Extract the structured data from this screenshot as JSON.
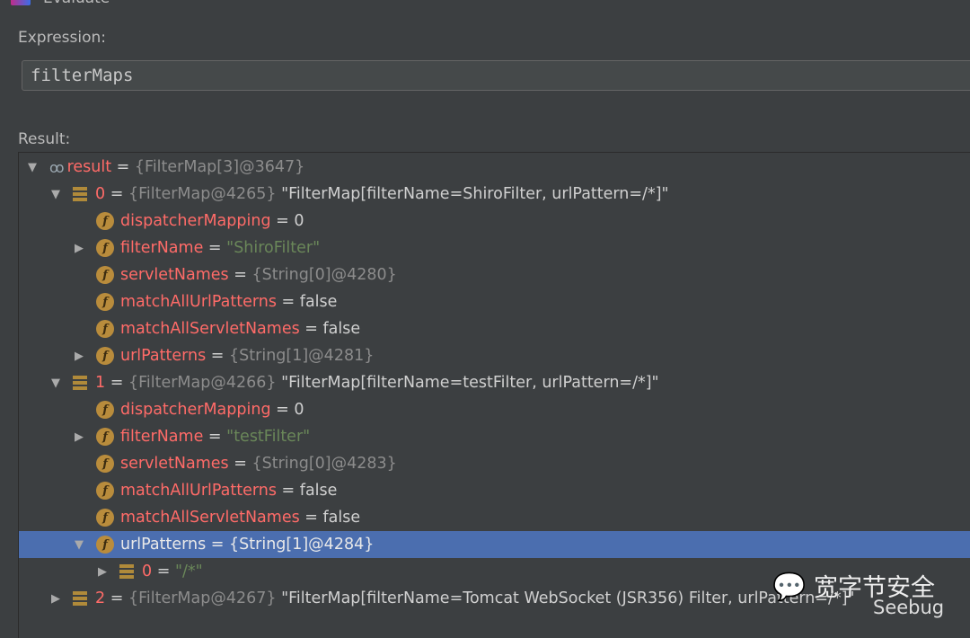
{
  "window": {
    "title": "Evaluate"
  },
  "expression": {
    "label": "Expression:",
    "value": "filterMaps"
  },
  "result": {
    "label": "Result:",
    "rows": [
      {
        "level": 0,
        "arrow": "down",
        "icon": "watch",
        "name": "result",
        "type": "{FilterMap[3]@3647}",
        "value": "",
        "kind": "val"
      },
      {
        "level": 1,
        "arrow": "down",
        "icon": "array",
        "name": "0",
        "type": "{FilterMap@4265}",
        "value": "\"FilterMap[filterName=ShiroFilter, urlPattern=/*]\"",
        "kind": "val"
      },
      {
        "level": 2,
        "arrow": "",
        "icon": "field",
        "name": "dispatcherMapping",
        "type": "",
        "value": "0",
        "kind": "val"
      },
      {
        "level": 2,
        "arrow": "right",
        "icon": "field",
        "name": "filterName",
        "type": "",
        "value": "\"ShiroFilter\"",
        "kind": "str"
      },
      {
        "level": 2,
        "arrow": "",
        "icon": "field",
        "name": "servletNames",
        "type": "{String[0]@4280}",
        "value": "",
        "kind": "val"
      },
      {
        "level": 2,
        "arrow": "",
        "icon": "field",
        "name": "matchAllUrlPatterns",
        "type": "",
        "value": "false",
        "kind": "val"
      },
      {
        "level": 2,
        "arrow": "",
        "icon": "field",
        "name": "matchAllServletNames",
        "type": "",
        "value": "false",
        "kind": "val"
      },
      {
        "level": 2,
        "arrow": "right",
        "icon": "field",
        "name": "urlPatterns",
        "type": "{String[1]@4281}",
        "value": "",
        "kind": "val"
      },
      {
        "level": 1,
        "arrow": "down",
        "icon": "array",
        "name": "1",
        "type": "{FilterMap@4266}",
        "value": "\"FilterMap[filterName=testFilter, urlPattern=/*]\"",
        "kind": "val"
      },
      {
        "level": 2,
        "arrow": "",
        "icon": "field",
        "name": "dispatcherMapping",
        "type": "",
        "value": "0",
        "kind": "val"
      },
      {
        "level": 2,
        "arrow": "right",
        "icon": "field",
        "name": "filterName",
        "type": "",
        "value": "\"testFilter\"",
        "kind": "str"
      },
      {
        "level": 2,
        "arrow": "",
        "icon": "field",
        "name": "servletNames",
        "type": "{String[0]@4283}",
        "value": "",
        "kind": "val"
      },
      {
        "level": 2,
        "arrow": "",
        "icon": "field",
        "name": "matchAllUrlPatterns",
        "type": "",
        "value": "false",
        "kind": "val"
      },
      {
        "level": 2,
        "arrow": "",
        "icon": "field",
        "name": "matchAllServletNames",
        "type": "",
        "value": "false",
        "kind": "val"
      },
      {
        "level": 2,
        "arrow": "down",
        "icon": "field",
        "name": "urlPatterns",
        "type": "{String[1]@4284}",
        "value": "",
        "kind": "val",
        "selected": true
      },
      {
        "level": 3,
        "arrow": "right",
        "icon": "array",
        "name": "0",
        "type": "",
        "value": "\"/*\"",
        "kind": "str"
      },
      {
        "level": 1,
        "arrow": "right",
        "icon": "array",
        "name": "2",
        "type": "{FilterMap@4267}",
        "value": "\"FilterMap[filterName=Tomcat WebSocket (JSR356) Filter, urlPattern=/*]\"",
        "kind": "val"
      }
    ]
  },
  "watermark": {
    "text": "宽字节安全",
    "brand": "Seebug"
  }
}
